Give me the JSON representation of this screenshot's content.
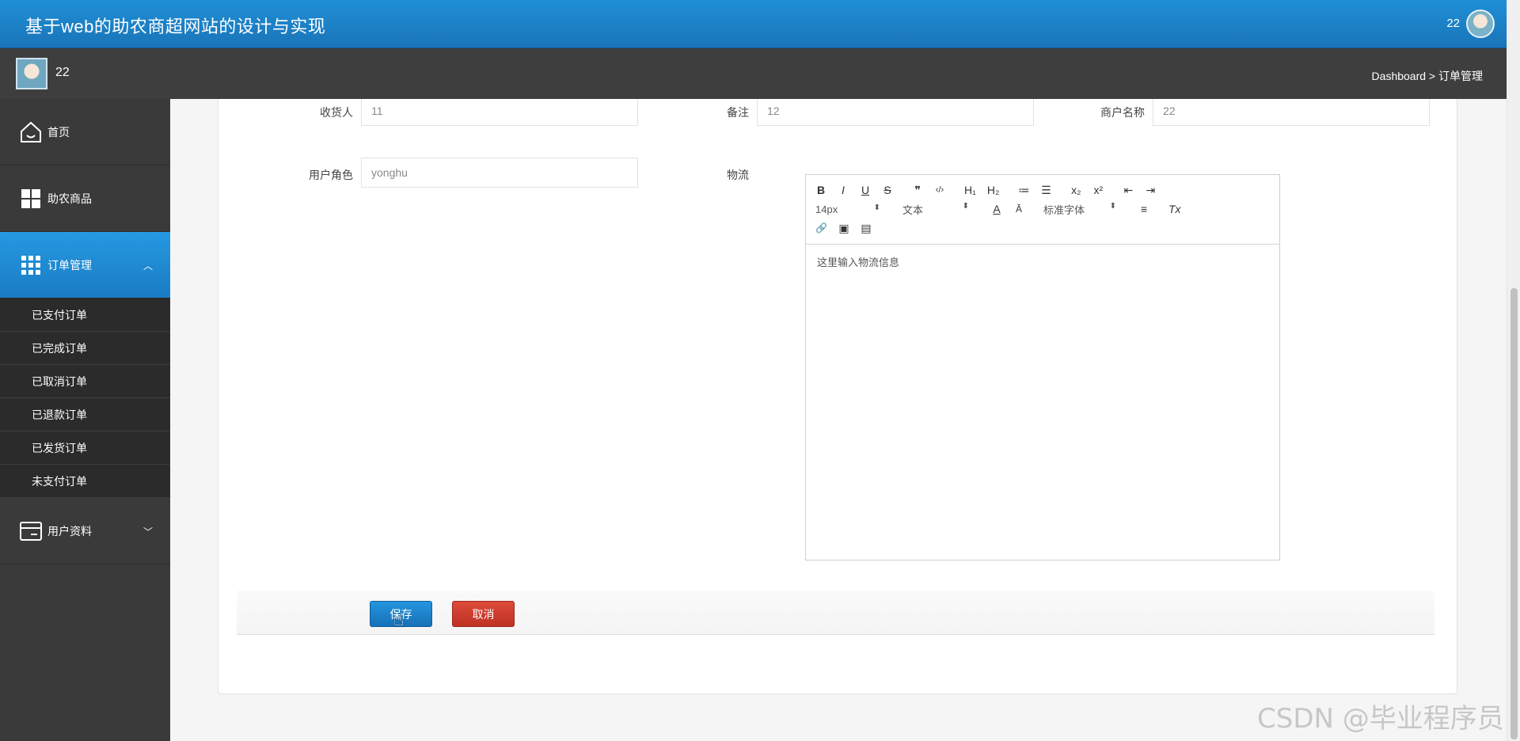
{
  "header": {
    "title": "基于web的助农商超网站的设计与实现",
    "user": "22"
  },
  "subheader": {
    "user": "22",
    "breadcrumb": "Dashboard > 订单管理"
  },
  "sidebar": {
    "items": [
      {
        "label": "首页",
        "icon": "home-icon"
      },
      {
        "label": "助农商品",
        "icon": "grid-icon"
      },
      {
        "label": "订单管理",
        "icon": "apps-icon",
        "active": true
      },
      {
        "label": "用户资料",
        "icon": "card-icon"
      }
    ],
    "orders_submenu": [
      "已支付订单",
      "已完成订单",
      "已取消订单",
      "已退款订单",
      "已发货订单",
      "未支付订单"
    ]
  },
  "form": {
    "receiver": {
      "label": "收货人",
      "value": "11"
    },
    "remark": {
      "label": "备注",
      "value": "12"
    },
    "merchant": {
      "label": "商户名称",
      "value": "22"
    },
    "user_role": {
      "label": "用户角色",
      "value": "yonghu"
    },
    "logistics": {
      "label": "物流",
      "placeholder": "这里输入物流信息"
    }
  },
  "editor": {
    "font_size": "14px",
    "paragraph": "文本",
    "font_family": "标准字体",
    "row1": [
      "B",
      "I",
      "U",
      "S",
      "❞",
      "‹/›",
      "H₁",
      "H₂",
      "≔",
      "☰",
      "x₂",
      "x²",
      "⇤",
      "⇥"
    ],
    "row2_icons": [
      "A",
      "Ā",
      "≡",
      "Tx"
    ],
    "row3": [
      "🔗",
      "▣",
      "▤"
    ]
  },
  "buttons": {
    "save": "保存",
    "cancel": "取消"
  },
  "watermark": "CSDN @毕业程序员"
}
